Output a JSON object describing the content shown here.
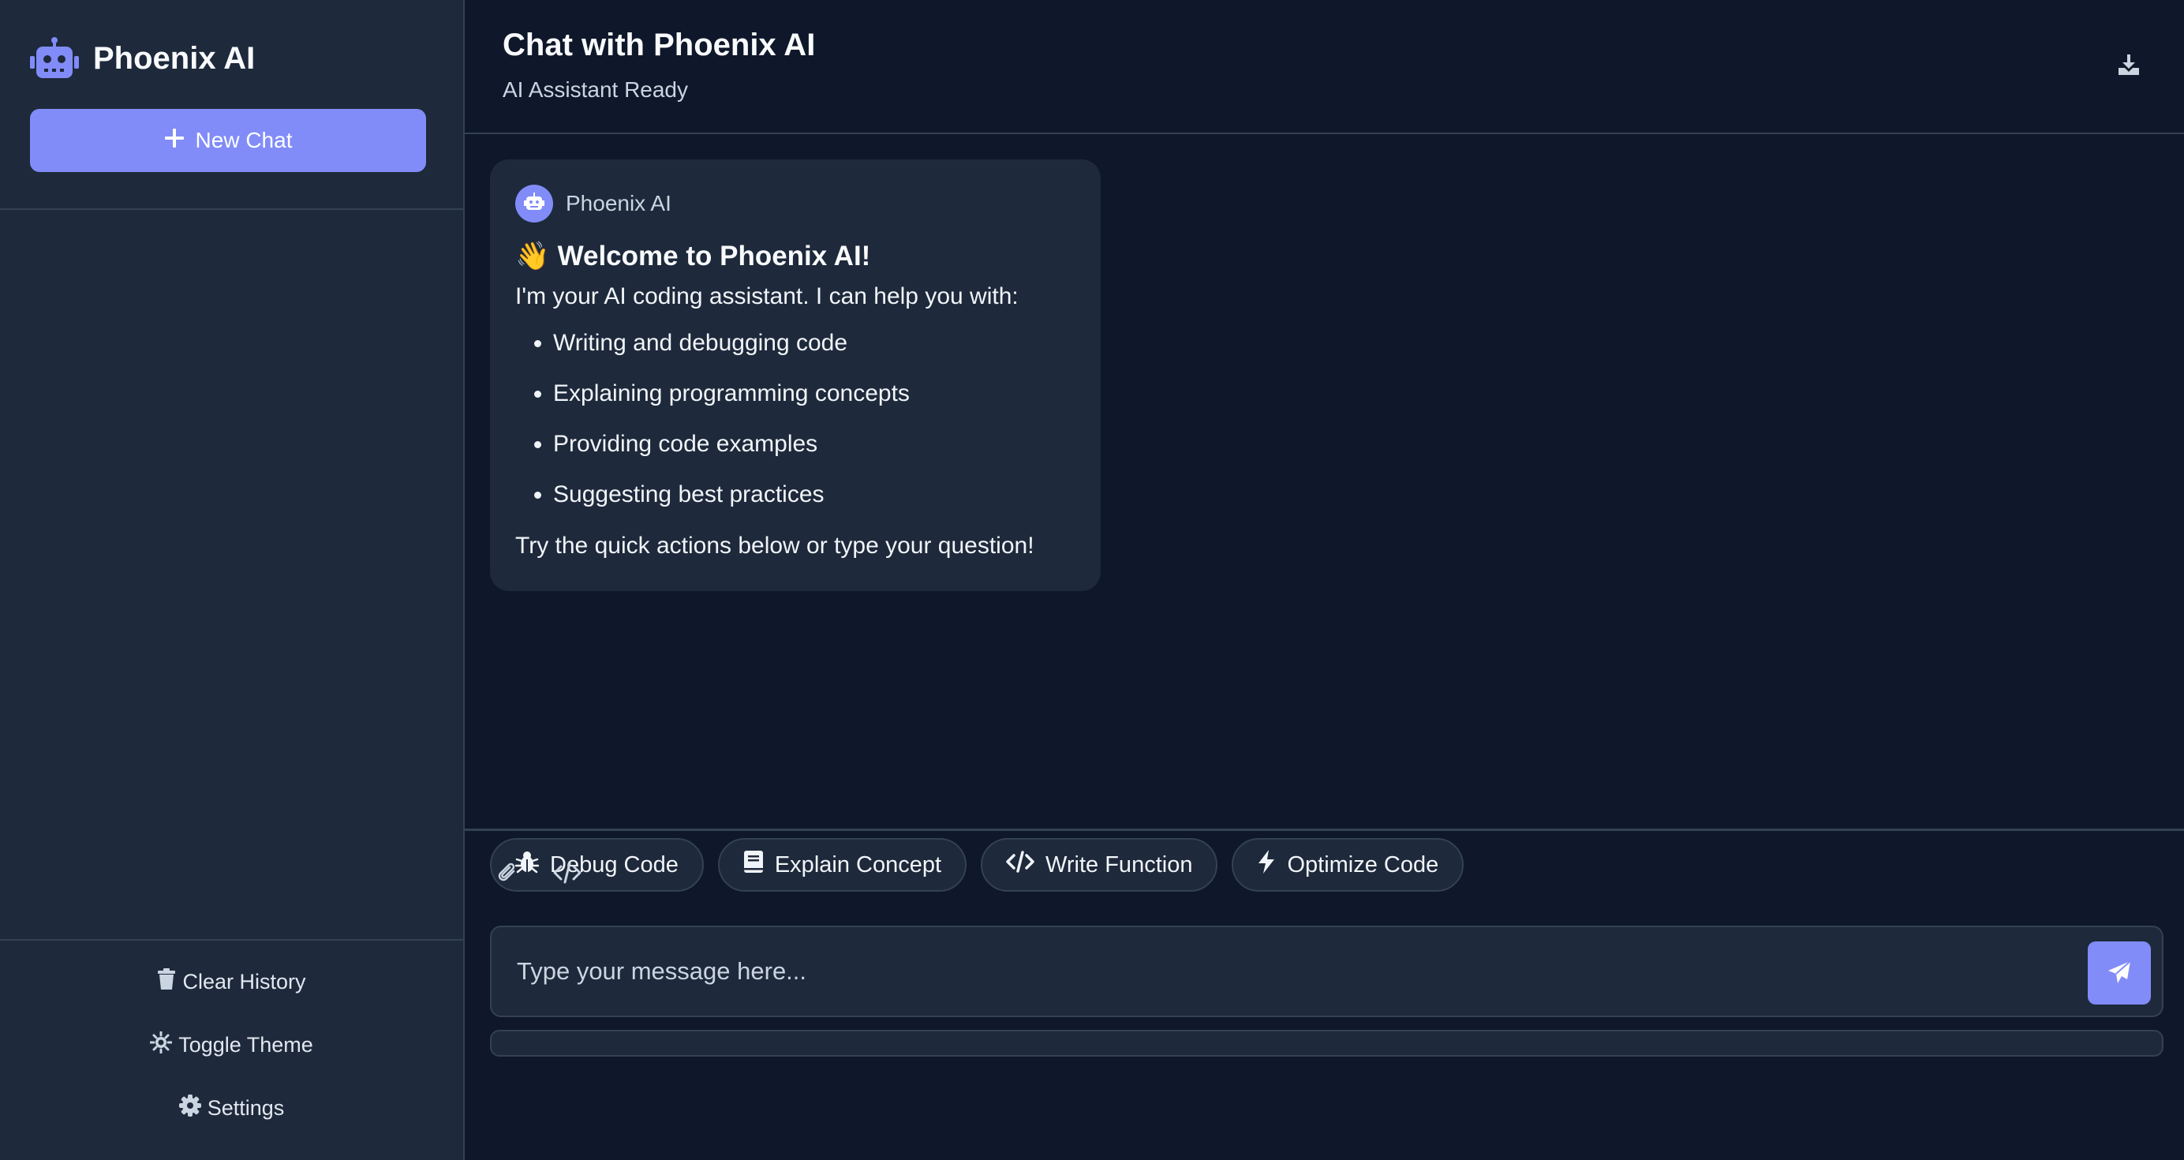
{
  "sidebar": {
    "brand_title": "Phoenix AI",
    "new_chat_label": "New Chat",
    "actions": {
      "clear_history": "Clear History",
      "toggle_theme": "Toggle Theme",
      "settings": "Settings"
    }
  },
  "header": {
    "title": "Chat with Phoenix AI",
    "subtitle": "AI Assistant Ready"
  },
  "message": {
    "sender": "Phoenix AI",
    "emoji": "👋",
    "welcome": "Welcome to Phoenix AI!",
    "intro": "I'm your AI coding assistant. I can help you with:",
    "items": [
      "Writing and debugging code",
      "Explaining programming concepts",
      "Providing code examples",
      "Suggesting best practices"
    ],
    "closing": "Try the quick actions below or type your question!"
  },
  "quick_actions": {
    "debug": "Debug Code",
    "explain": "Explain Concept",
    "write": "Write Function",
    "optimize": "Optimize Code"
  },
  "composer": {
    "placeholder": "Type your message here..."
  },
  "colors": {
    "accent": "#818cf8",
    "background": "#0f172a",
    "surface": "#1e293b",
    "border": "#334155"
  }
}
